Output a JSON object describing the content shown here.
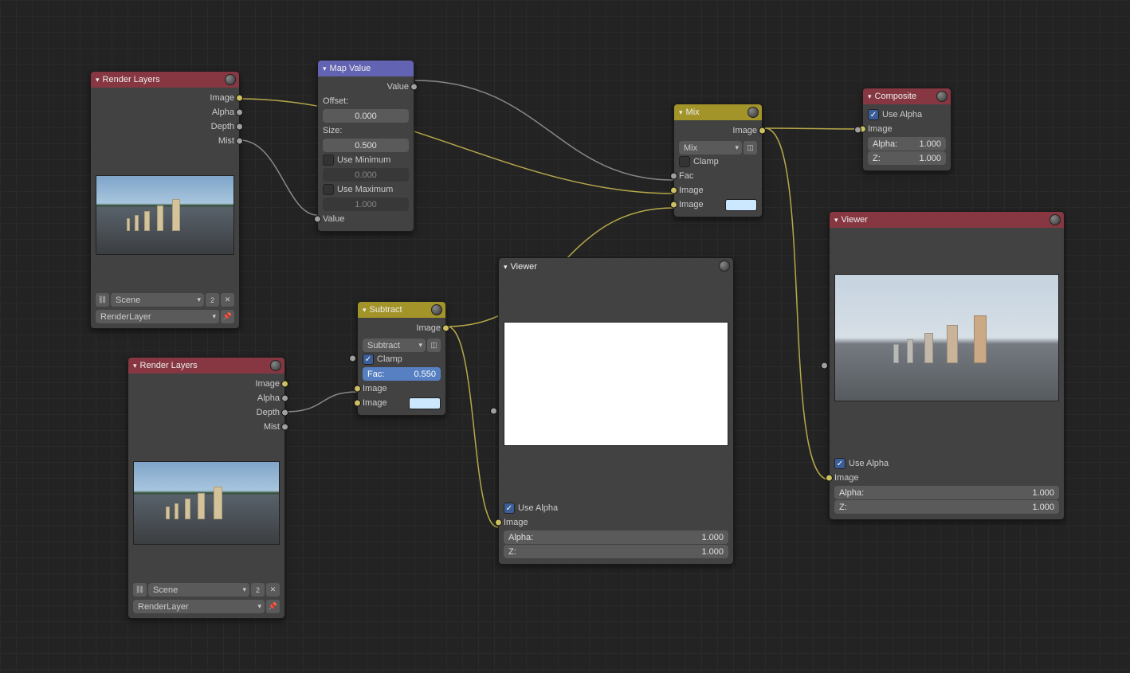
{
  "nodes": {
    "renderLayers1": {
      "title": "Render Layers",
      "outputs": [
        "Image",
        "Alpha",
        "Depth",
        "Mist"
      ],
      "scene": "Scene",
      "sceneNum": "2",
      "layer": "RenderLayer"
    },
    "renderLayers2": {
      "title": "Render Layers",
      "outputs": [
        "Image",
        "Alpha",
        "Depth",
        "Mist"
      ],
      "scene": "Scene",
      "sceneNum": "2",
      "layer": "RenderLayer"
    },
    "mapValue": {
      "title": "Map Value",
      "out": "Value",
      "offsetLabel": "Offset:",
      "offset": "0.000",
      "sizeLabel": "Size:",
      "size": "0.500",
      "useMin": "Use Minimum",
      "min": "0.000",
      "useMax": "Use Maximum",
      "max": "1.000",
      "in": "Value"
    },
    "subtract": {
      "title": "Subtract",
      "out": "Image",
      "blend": "Subtract",
      "clampLabel": "Clamp",
      "facLabel": "Fac:",
      "fac": "0.550",
      "in1": "Image",
      "in2": "Image"
    },
    "mix": {
      "title": "Mix",
      "out": "Image",
      "blend": "Mix",
      "clampLabel": "Clamp",
      "inFac": "Fac",
      "in1": "Image",
      "in2": "Image"
    },
    "composite": {
      "title": "Composite",
      "useAlpha": "Use Alpha",
      "inImage": "Image",
      "alphaLabel": "Alpha:",
      "alpha": "1.000",
      "zLabel": "Z:",
      "z": "1.000"
    },
    "viewer1": {
      "title": "Viewer",
      "useAlpha": "Use Alpha",
      "inImage": "Image",
      "alphaLabel": "Alpha:",
      "alpha": "1.000",
      "zLabel": "Z:",
      "z": "1.000"
    },
    "viewer2": {
      "title": "Viewer",
      "useAlpha": "Use Alpha",
      "inImage": "Image",
      "alphaLabel": "Alpha:",
      "alpha": "1.000",
      "zLabel": "Z:",
      "z": "1.000"
    }
  }
}
